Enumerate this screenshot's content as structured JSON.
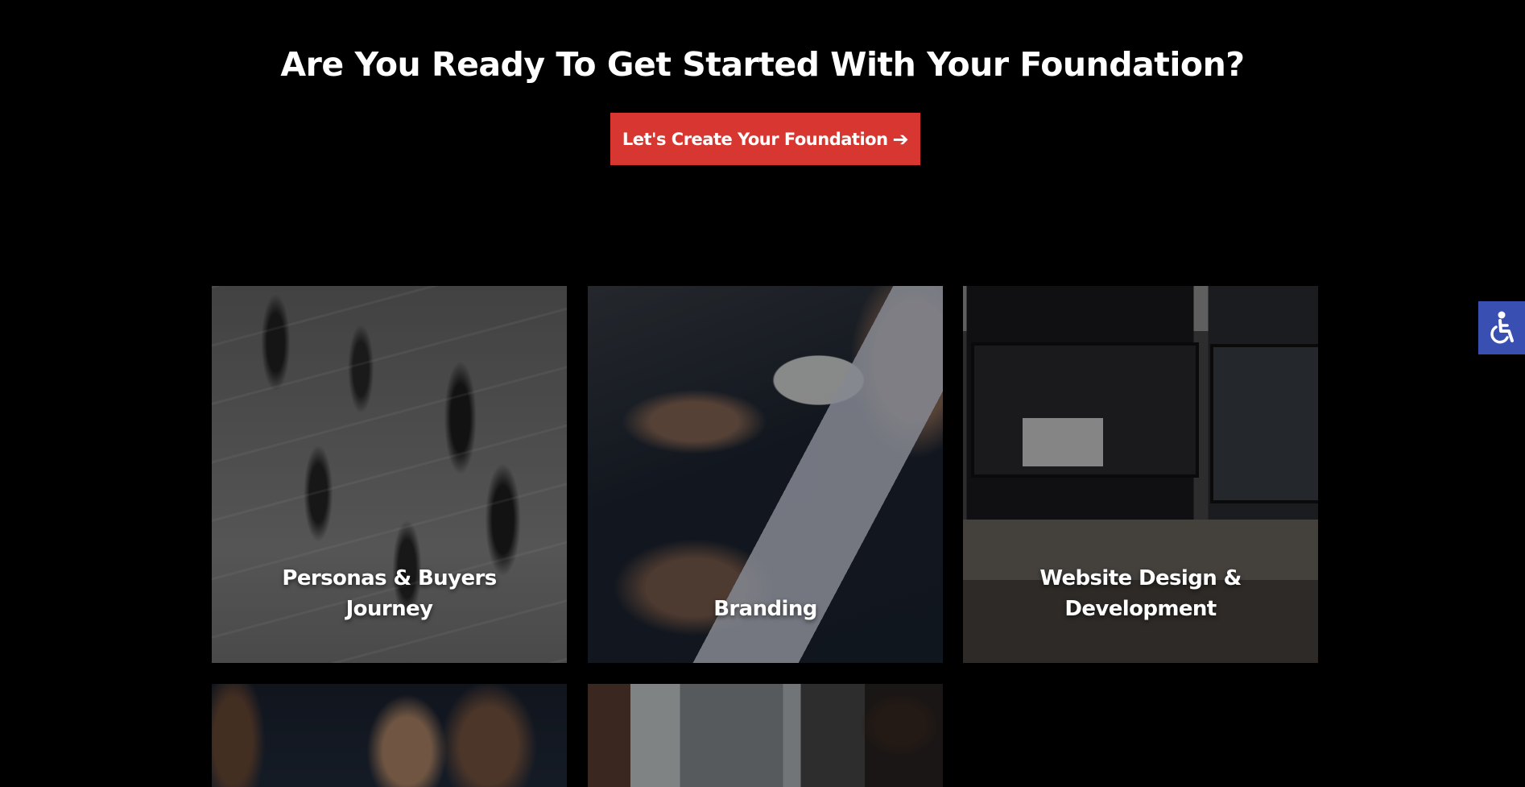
{
  "hero": {
    "title": "Are You Ready To Get Started With Your Foundation?",
    "cta_label": "Let's Create Your Foundation",
    "cta_icon": "arrow-right-icon",
    "cta_color": "#d73730"
  },
  "services": [
    {
      "label": "Personas & Buyers Journey"
    },
    {
      "label": "Branding"
    },
    {
      "label": "Website Design & Development"
    },
    {
      "label": ""
    },
    {
      "label": ""
    }
  ],
  "accessibility": {
    "icon": "wheelchair-accessibility-icon",
    "color": "#3a4fb2"
  }
}
